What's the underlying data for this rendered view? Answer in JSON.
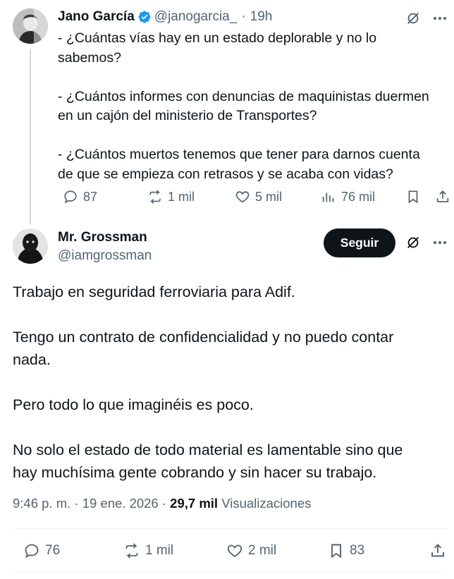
{
  "tweet1": {
    "name": "Jano García",
    "handle": "@janogarcia_",
    "separator": "·",
    "time": "19h",
    "lines": [
      "- ¿Cuántas vías hay en un estado deplorable y no lo",
      "sabemos?",
      "",
      "- ¿Cuántos informes con denuncias de maquinistas duermen",
      "en un cajón del ministerio de Transportes?",
      "",
      "- ¿Cuántos muertos tenemos que tener para darnos cuenta",
      "de que se empieza con retrasos y se acaba con vidas?"
    ],
    "replies": "87",
    "reposts": "1 mil",
    "likes": "5 mil",
    "views": "76 mil"
  },
  "tweet2": {
    "name": "Mr. Grossman",
    "handle": "@iamgrossman",
    "follow_label": "Seguir",
    "lines": [
      "Trabajo en seguridad ferroviaria para Adif.",
      "",
      "Tengo un contrato de confidencialidad y no puedo contar",
      "nada.",
      "",
      "Pero todo lo que imaginéis es poco.",
      "",
      "No solo el estado de todo material es lamentable sino que",
      "hay muchísima gente cobrando y sin hacer su trabajo."
    ],
    "timestamp": "9:46 p. m. · 19 ene. 2026 ·",
    "views_count": "29,7 mil",
    "views_label": "Visualizaciones",
    "replies": "76",
    "reposts": "1 mil",
    "likes": "2 mil",
    "bookmarks": "83"
  },
  "colors": {
    "text": "#0f1419",
    "secondary": "#536471",
    "verified": "#1d9bf0",
    "button_bg": "#0f1419"
  },
  "icons": [
    "verified-badge-icon",
    "grok-icon",
    "more-icon",
    "reply-icon",
    "repost-icon",
    "like-icon",
    "views-icon",
    "bookmark-icon",
    "share-icon"
  ]
}
